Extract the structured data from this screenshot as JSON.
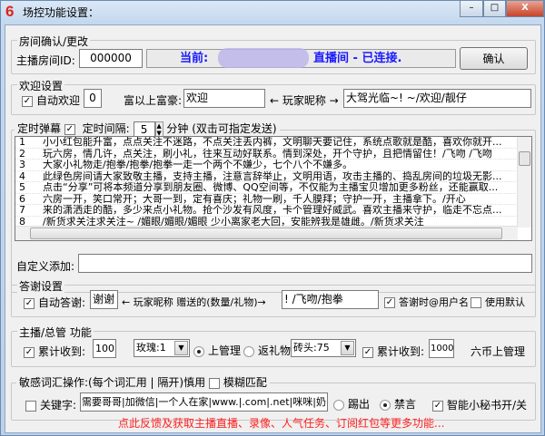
{
  "window": {
    "title": "场控功能设置：",
    "logo": "6",
    "minimize": "–",
    "maximize": "□",
    "close": "X"
  },
  "room": {
    "group": "房间确认/更改",
    "id_label": "主播房间ID:",
    "id_value": "000000",
    "status_prefix": "当前:",
    "status_suffix": "直播间  - 已连接.",
    "confirm": "确认",
    "status_color": "#1a1aff"
  },
  "welcome": {
    "group": "欢迎设置",
    "auto_label": "自动欢迎",
    "auto_checked": true,
    "level_value": "0",
    "rich_label": "富以上富豪:",
    "prefix_value": "欢迎",
    "arrow_label": "← 玩家昵称 →",
    "suffix_value": "大驾光临~! ~/欢迎/靓仔"
  },
  "timer": {
    "label": "定时弹幕",
    "checked": true,
    "interval_label": "定时间隔:",
    "interval_value": "5",
    "unit_label": "分钟 (双击可指定发送)",
    "messages": [
      {
        "n": "1",
        "text": "小小红包能升富，点点关注不迷路，不点关注丢内裤，文明聊天要记住，系统点歌就是酷，喜欢你就开..."
      },
      {
        "n": "2",
        "text": "玩六房，情几许，点关注，刷小礼，往来互动好联系。情到深处，开个守护，且把情留住！/飞吻 /飞吻"
      },
      {
        "n": "3",
        "text": "大家小礼物走/抱拳/抱拳/抱拳一走一个两个不嫌少，七个八个不嫌多。"
      },
      {
        "n": "4",
        "text": "此绿色房间请大家致敬主播，支持主播，注意言辞举止，文明用语，攻击主播的、捣乱房间的垃圾无影..."
      },
      {
        "n": "5",
        "text": "点击“分享”可将本频道分享到朋友圈、微博、QQ空间等，不仅能为主播宝贝增加更多粉丝，还能赢取..."
      },
      {
        "n": "6",
        "text": "六房一开，笑口常开；大哥一到，定有喜庆；礼物一刷，千人膜拜；守护一开，主播拿下。/开心"
      },
      {
        "n": "7",
        "text": "来的潇洒走的酷，多少来点小礼物。抢个沙发有风度，卡个管理好威武。喜欢主播来守护，临走不忘点..."
      },
      {
        "n": "8",
        "text": "/新货求关注求关注~ /媚眼/媚眼/媚眼 少小离家老大回，安能辨我是雄雌。/新货求关注"
      }
    ],
    "custom_label": "自定义添加:",
    "custom_value": ""
  },
  "thanks": {
    "group": "答谢设置",
    "auto_label": "自动答谢:",
    "auto_checked": true,
    "prefix_value": "谢谢",
    "middle_label": "← 玩家昵称 赠送的(数量/礼物)→",
    "suffix_value": "! /飞吻/抱拳",
    "at_label": "答谢时@用户名",
    "at_checked": true,
    "default_label": "使用默认",
    "default_checked": false
  },
  "host": {
    "group": "主播/总管 功能",
    "recv_label": "累计收到:",
    "recv_checked": true,
    "recv_value": "100",
    "gift_select": "玫瑰:1",
    "radio_admin": "上管理",
    "radio_admin_selected": true,
    "radio_return": "返礼物",
    "brick_select": "砖头:75",
    "recv2_label": "累计收到:",
    "recv2_checked": true,
    "recv2_value": "1000",
    "coin_label": "六币上管理"
  },
  "sensitive": {
    "group": "敏感词汇操作:(每个词汇用 | 隔开)慎用",
    "fuzzy_label": "模糊匹配",
    "fuzzy_checked": false,
    "keyword_label": "关键字:",
    "keyword_checked": false,
    "keyword_value": "需要哥哥|加微信|一个人在家|www.|.com|.net|咪咪|奶",
    "kick_label": "踢出",
    "mute_label": "禁言",
    "mute_selected": true,
    "secretary_label": "智能小秘书开/关",
    "secretary_checked": true
  },
  "footer": {
    "link": "点此反馈及获取主播直播、录像、人气任务、订阅红包等更多功能...",
    "color": "#ff2020"
  }
}
